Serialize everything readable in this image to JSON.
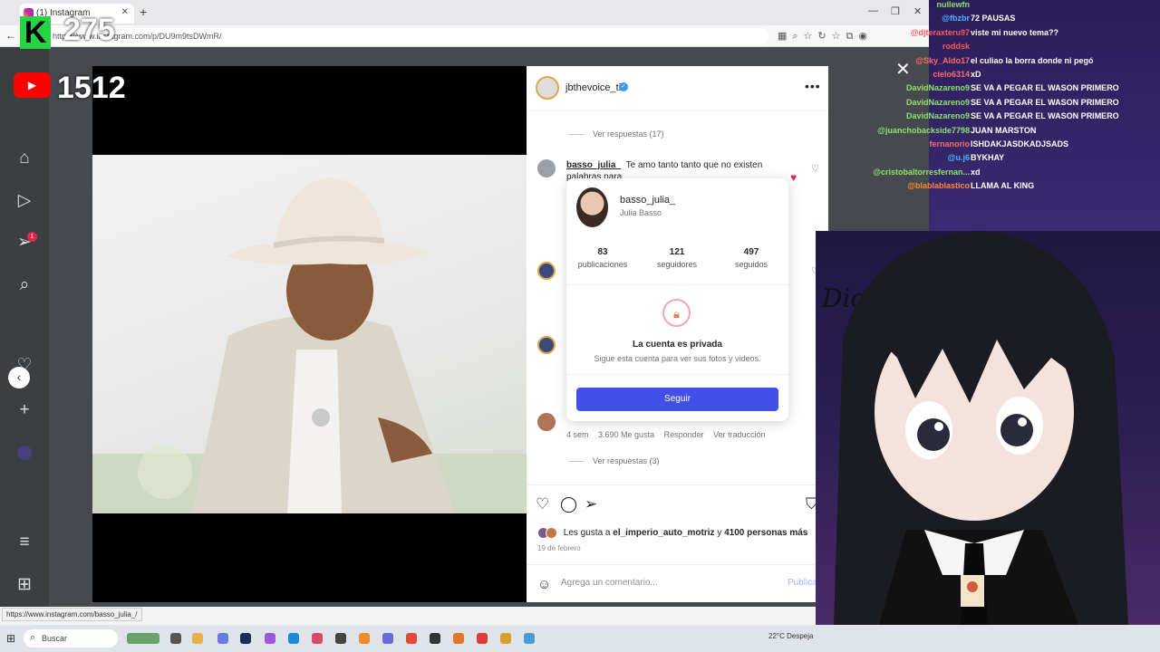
{
  "browser": {
    "tab_title": "(1) Instagram",
    "address": "https://www.instagram.com/p/DU9m9tsDWmR/",
    "status_url": "https://www.instagram.com/basso_julia_/"
  },
  "post": {
    "author": "jbthevoice_tir",
    "verified_icon": "verified-badge-icon",
    "view_replies_1": "Ver respuestas (17)",
    "comment_user": "basso_julia_",
    "comment_text": "Te amo tanto tanto que no existen palabras para",
    "meta": {
      "age": "4 sem",
      "likes": "3.690 Me gusta",
      "reply": "Responder",
      "translate": "Ver traducción"
    },
    "view_replies_2": "Ver respuestas (3)",
    "liked_by_prefix": "Les gusta a",
    "liked_by_user": "el_imperio_auto_motriz",
    "liked_by_and": "y",
    "liked_by_count": "4100 personas más",
    "date": "19 de febrero",
    "comment_placeholder": "Agrega un comentario...",
    "publish": "Publicar"
  },
  "hovercard": {
    "username": "basso_julia_",
    "full_name": "Julia Basso",
    "stats": [
      {
        "number": "83",
        "label": "publicaciones"
      },
      {
        "number": "121",
        "label": "seguidores"
      },
      {
        "number": "497",
        "label": "seguidos"
      }
    ],
    "private_title": "La cuenta es privada",
    "private_sub": "Sigue esta cuenta para ver sus fotos y videos.",
    "follow": "Seguir"
  },
  "taskbar": {
    "search": "Buscar",
    "weather": "22°C  Despeja"
  },
  "stream": {
    "kick_logo": "K",
    "kick_viewers": "275",
    "youtube_viewers": "1512",
    "overlay_text": "Dios Te Ama"
  },
  "chat": [
    {
      "user": "nullewfn",
      "msg": "",
      "color": "#8fe36b"
    },
    {
      "user": "@fbzbr",
      "msg": "72 PAUSAS",
      "color": "#4ab3ff"
    },
    {
      "user": "@djteraxteru97",
      "msg": "viste mi nuevo tema??",
      "color": "#ff5a5a"
    },
    {
      "user": "roddsk",
      "msg": "",
      "color": "#ff5a5a"
    },
    {
      "user": "@Sky_Aldo17",
      "msg": "el culiao la borra donde ni pegó",
      "color": "#ff6b6b"
    },
    {
      "user": "cielo6314",
      "msg": "xD",
      "color": "#ff6b6b"
    },
    {
      "user": "DavidNazareno9",
      "msg": "SE VA A PEGAR EL WASON PRIMERO",
      "color": "#8fe36b"
    },
    {
      "user": "DavidNazareno9",
      "msg": "SE VA A PEGAR EL WASON PRIMERO",
      "color": "#8fe36b"
    },
    {
      "user": "DavidNazareno9",
      "msg": "SE VA A PEGAR EL WASON PRIMERO",
      "color": "#8fe36b"
    },
    {
      "user": "@juanchobackside7798",
      "msg": "JUAN MARSTON",
      "color": "#8fe36b"
    },
    {
      "user": "fernanorio",
      "msg": "ISHDAKJASDKADJSADS",
      "color": "#ff6b6b"
    },
    {
      "user": "@u.j6",
      "msg": "BYKHAY",
      "color": "#4ab3ff"
    },
    {
      "user": "@cristobaltorresfernan...",
      "msg": "xd",
      "color": "#8fe36b"
    },
    {
      "user": "@blablablastico",
      "msg": "LLAMA AL KING",
      "color": "#ff8a3d"
    }
  ]
}
